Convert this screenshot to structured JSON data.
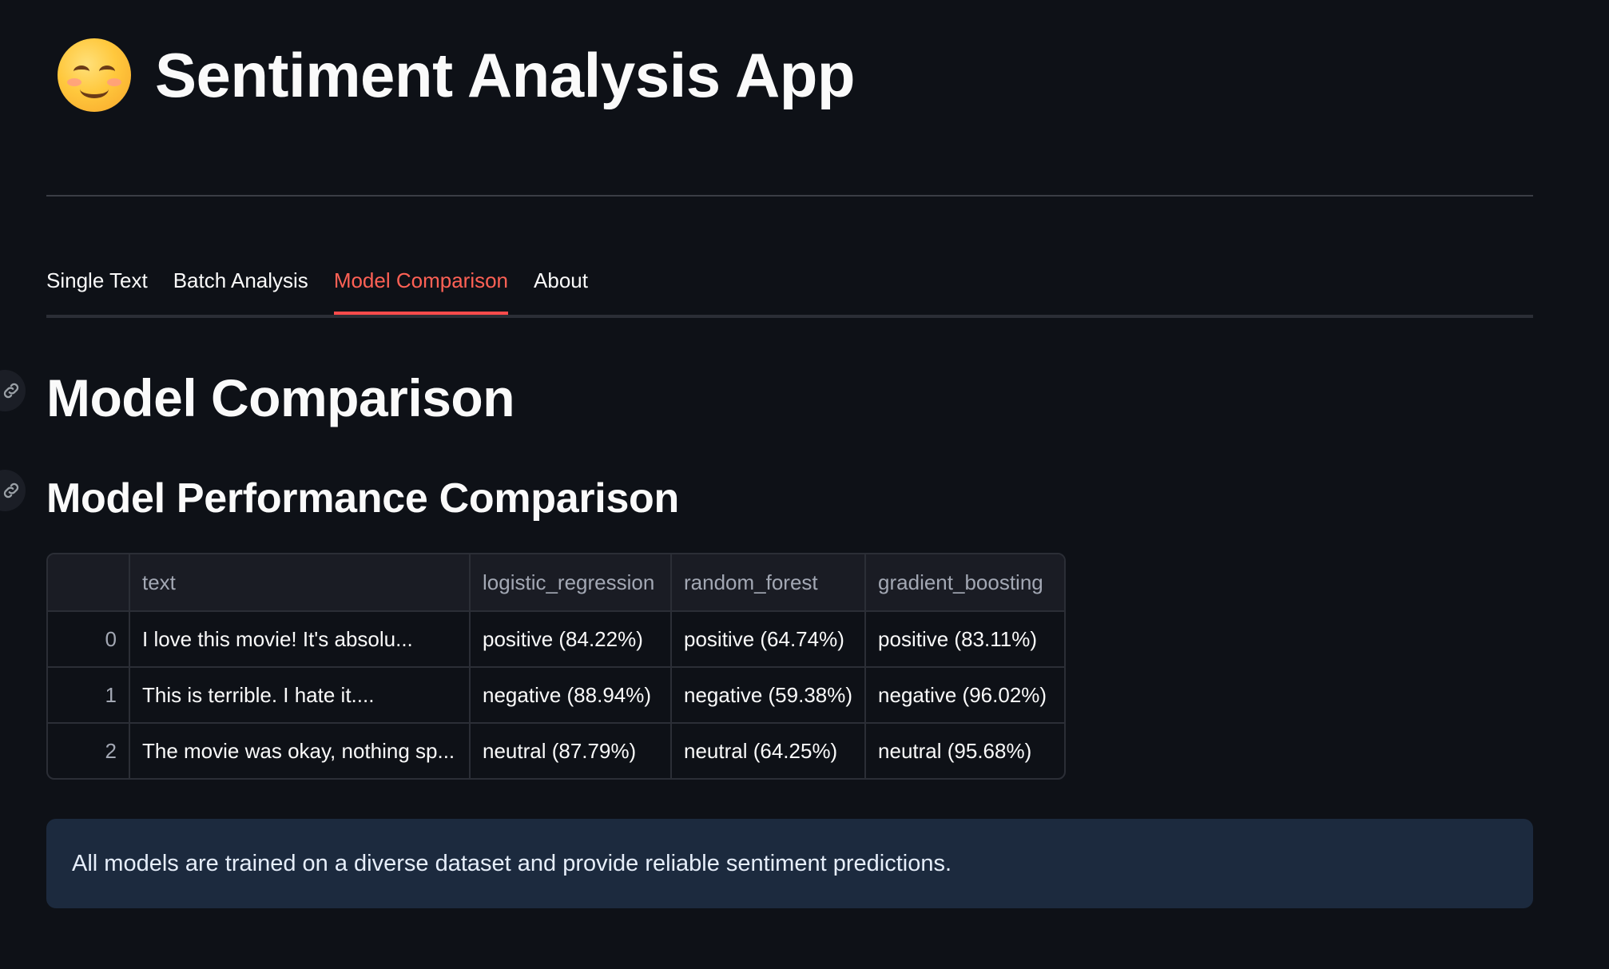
{
  "app": {
    "title": "Sentiment Analysis App",
    "icon": "smiling-face-emoji"
  },
  "tabs": [
    {
      "label": "Single Text",
      "active": false
    },
    {
      "label": "Batch Analysis",
      "active": false
    },
    {
      "label": "Model Comparison",
      "active": true
    },
    {
      "label": "About",
      "active": false
    }
  ],
  "main": {
    "heading": "Model Comparison",
    "subheading": "Model Performance Comparison",
    "table": {
      "columns": [
        "",
        "text",
        "logistic_regression",
        "random_forest",
        "gradient_boosting"
      ],
      "rows": [
        [
          "0",
          "I love this movie! It's absolu...",
          "positive (84.22%)",
          "positive (64.74%)",
          "positive (83.11%)"
        ],
        [
          "1",
          "This is terrible. I hate it....",
          "negative (88.94%)",
          "negative (59.38%)",
          "negative (96.02%)"
        ],
        [
          "2",
          "The movie was okay, nothing sp...",
          "neutral (87.79%)",
          "neutral (64.25%)",
          "neutral (95.68%)"
        ]
      ]
    },
    "info": "All models are trained on a diverse dataset and provide reliable sentiment predictions."
  },
  "colors": {
    "background": "#0e1117",
    "accent": "#ff4b4b",
    "info_background": "#1c2a3e"
  }
}
